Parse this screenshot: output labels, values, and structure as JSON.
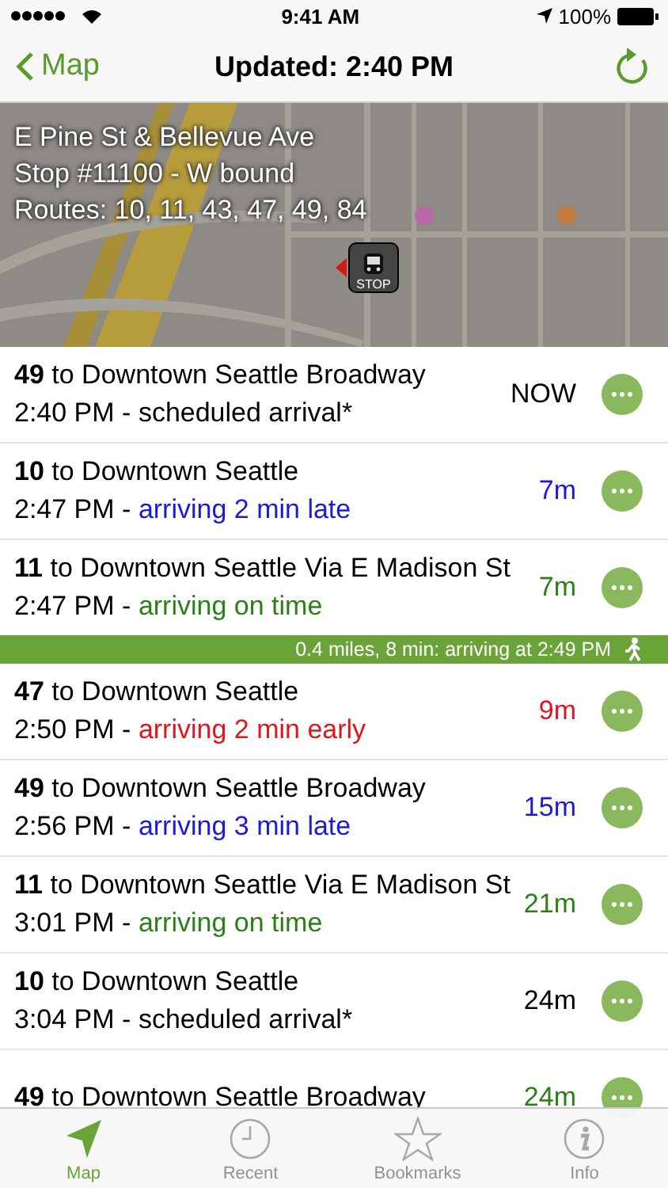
{
  "status_bar": {
    "time": "9:41 AM",
    "battery": "100%"
  },
  "nav": {
    "back": "Map",
    "title": "Updated: 2:40 PM"
  },
  "stop": {
    "lines": [
      "E Pine St & Bellevue Ave",
      "Stop #11100 - W bound",
      "Routes: 10, 11, 43, 47, 49, 84"
    ],
    "marker": "STOP"
  },
  "arrivals": [
    {
      "route": "49",
      "destination": "to Downtown Seattle Broadway",
      "time": "2:40 PM -",
      "status": "scheduled arrival*",
      "kind": "scheduled",
      "eta": "NOW"
    },
    {
      "route": "10",
      "destination": "to Downtown Seattle",
      "time": "2:47 PM -",
      "status": "arriving 2 min late",
      "kind": "late",
      "eta": "7m"
    },
    {
      "route": "11",
      "destination": "to Downtown Seattle Via E Madison St",
      "time": "2:47 PM -",
      "status": "arriving on time",
      "kind": "ontime",
      "eta": "7m"
    },
    {
      "kind": "walk",
      "text": "0.4 miles, 8 min: arriving at 2:49 PM"
    },
    {
      "route": "47",
      "destination": "to Downtown Seattle",
      "time": "2:50 PM -",
      "status": "arriving 2 min early",
      "kind": "early",
      "eta": "9m"
    },
    {
      "route": "49",
      "destination": "to Downtown Seattle Broadway",
      "time": "2:56 PM -",
      "status": "arriving 3 min late",
      "kind": "late",
      "eta": "15m"
    },
    {
      "route": "11",
      "destination": "to Downtown Seattle Via E Madison St",
      "time": "3:01 PM -",
      "status": "arriving on time",
      "kind": "ontime",
      "eta": "21m"
    },
    {
      "route": "10",
      "destination": "to Downtown Seattle",
      "time": "3:04 PM -",
      "status": "scheduled arrival*",
      "kind": "scheduled",
      "eta": "24m"
    },
    {
      "route": "49",
      "destination": "to Downtown Seattle Broadway",
      "kind": "ontime",
      "eta": "24m"
    }
  ],
  "tabs": [
    {
      "label": "Map",
      "selected": true
    },
    {
      "label": "Recent",
      "selected": false
    },
    {
      "label": "Bookmarks",
      "selected": false
    },
    {
      "label": "Info",
      "selected": false
    }
  ]
}
